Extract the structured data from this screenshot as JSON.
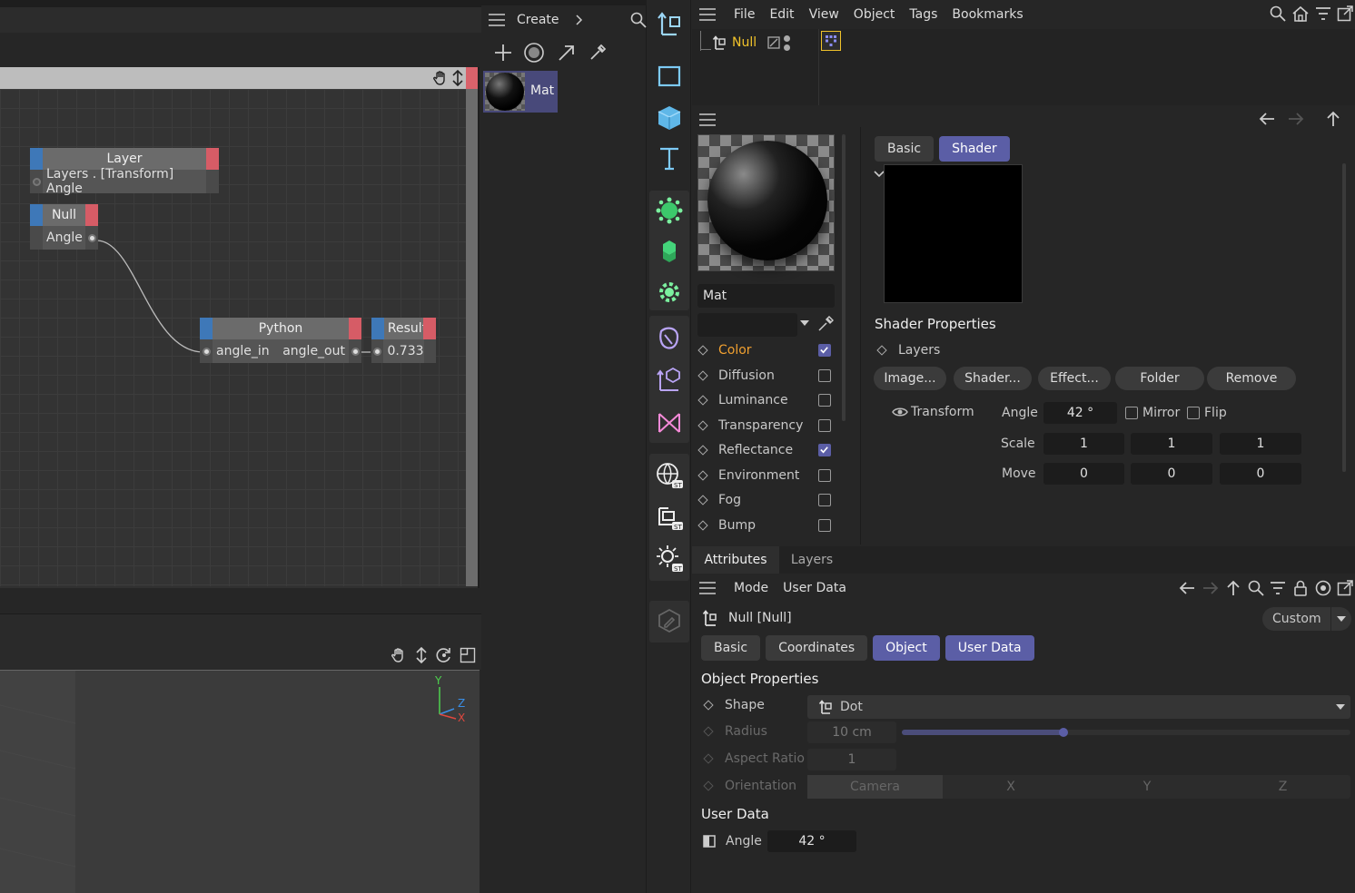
{
  "matman": {
    "create_label": "Create",
    "material_name": "Mat"
  },
  "xpresso": {
    "layer_node": {
      "title": "Layer",
      "port": "Layers . [Transform] Angle"
    },
    "null_node": {
      "title": "Null",
      "port": "Angle"
    },
    "python_node": {
      "title": "Python",
      "in_port": "angle_in",
      "out_port": "angle_out"
    },
    "result_node": {
      "title": "Result",
      "value": "0.733"
    }
  },
  "viewport": {
    "axis_y": "Y",
    "axis_z": "Z",
    "axis_x": "X"
  },
  "objman": {
    "menu": [
      "File",
      "Edit",
      "View",
      "Object",
      "Tags",
      "Bookmarks"
    ],
    "object_name": "Null"
  },
  "matedit": {
    "material_name": "Mat",
    "tabs": [
      "Basic",
      "Shader"
    ],
    "channels": [
      {
        "label": "Color",
        "checked": true,
        "active": true
      },
      {
        "label": "Diffusion",
        "checked": false
      },
      {
        "label": "Luminance",
        "checked": false
      },
      {
        "label": "Transparency",
        "checked": false
      },
      {
        "label": "Reflectance",
        "checked": true
      },
      {
        "label": "Environment",
        "checked": false
      },
      {
        "label": "Fog",
        "checked": false
      },
      {
        "label": "Bump",
        "checked": false
      }
    ],
    "shader_properties_title": "Shader Properties",
    "layers_label": "Layers",
    "buttons": [
      "Image...",
      "Shader...",
      "Effect...",
      "Folder",
      "Remove"
    ],
    "transform_label": "Transform",
    "angle_label": "Angle",
    "angle_value": "42 °",
    "mirror_label": "Mirror",
    "flip_label": "Flip",
    "scale_label": "Scale",
    "scale_values": [
      "1",
      "1",
      "1"
    ],
    "move_label": "Move",
    "move_values": [
      "0",
      "0",
      "0"
    ]
  },
  "attr": {
    "tabs_top": [
      "Attributes",
      "Layers"
    ],
    "menu": [
      "Mode",
      "User Data"
    ],
    "object_title": "Null [Null]",
    "preset": "Custom",
    "tabs": [
      "Basic",
      "Coordinates",
      "Object",
      "User Data"
    ],
    "object_properties_title": "Object Properties",
    "shape_label": "Shape",
    "shape_value": "Dot",
    "radius_label": "Radius",
    "radius_value": "10 cm",
    "radius_slider": 0.36,
    "aspect_label": "Aspect Ratio",
    "aspect_value": "1",
    "orientation_label": "Orientation",
    "orientation_options": [
      "Camera",
      "X",
      "Y",
      "Z"
    ],
    "user_data_title": "User Data",
    "user_angle_label": "Angle",
    "user_angle_value": "42 °"
  },
  "colors": {
    "accent": "#5b5ea6",
    "active_object": "#f0c22a",
    "port_blue": "#3e78b8",
    "port_red": "#d65c66"
  }
}
